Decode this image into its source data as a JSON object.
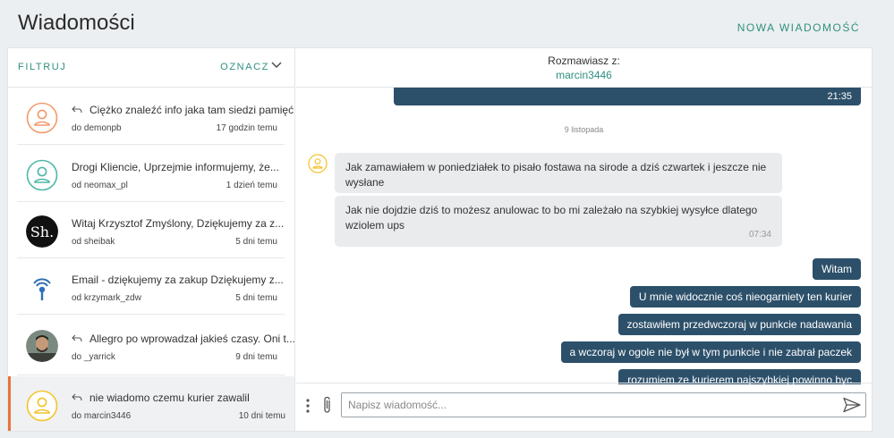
{
  "header": {
    "title": "Wiadomości",
    "new_message": "NOWA WIADOMOŚĆ"
  },
  "list_header": {
    "filter": "FILTRUJ",
    "mark": "OZNACZ"
  },
  "conversations": [
    {
      "preview": "Ciężko znaleźć info jaka tam siedzi pamięć...",
      "from": "do demonpb",
      "time": "17 godzin temu",
      "reply": true,
      "avatar": "user-outline-orange"
    },
    {
      "preview": "Drogi Kliencie, Uprzejmie informujemy, że...",
      "from": "od neomax_pl",
      "time": "1 dzień temu",
      "reply": false,
      "avatar": "user-outline-teal"
    },
    {
      "preview": "Witaj Krzysztof Zmyślony, Dziękujemy za z...",
      "from": "od sheibak",
      "time": "5 dni temu",
      "reply": false,
      "avatar": "sh-logo",
      "avatar_text": "Sh."
    },
    {
      "preview": "Email - dziękujemy za zakup Dziękujemy z...",
      "from": "od krzymark_zdw",
      "time": "5 dni temu",
      "reply": false,
      "avatar": "broadcast-logo"
    },
    {
      "preview": "Allegro po wprowadzał jakieś czasy. Oni t...",
      "from": "do _yarrick",
      "time": "9 dni temu",
      "reply": true,
      "avatar": "photo"
    },
    {
      "preview": "nie wiadomo czemu kurier zawalil",
      "from": "do marcin3446",
      "time": "10 dni temu",
      "reply": true,
      "avatar": "user-outline-yellow",
      "active": true
    }
  ],
  "chat": {
    "label": "Rozmawiasz z:",
    "username": "marcin3446",
    "prev_time": "21:35",
    "date_separator": "9 listopada",
    "incoming": [
      "Jak zamawiałem w poniedziałek to pisało fostawa na sirode a dziś czwartek i jeszcze nie wysłane",
      "Jak nie dojdzie dziś to możesz anulowac to bo mi zależało na szybkiej wysyłce dlatego wziolem ups"
    ],
    "incoming_time": "07:34",
    "outgoing": [
      "Witam",
      "U mnie widocznie coś nieogarniety ten kurier",
      "zostawiłem przedwczoraj w punkcie nadawania",
      "a wczoraj w ogole nie był w tym punkcie i nie zabrał paczek",
      "rozumiem ze kurierem najszybkiej powinno byc"
    ]
  },
  "composer": {
    "placeholder": "Napisz wiadomość..."
  },
  "colors": {
    "accent": "#2f8f7f",
    "bubble_out": "#2d506a",
    "bubble_in": "#e9ebed",
    "active_marker": "#e8733a"
  }
}
